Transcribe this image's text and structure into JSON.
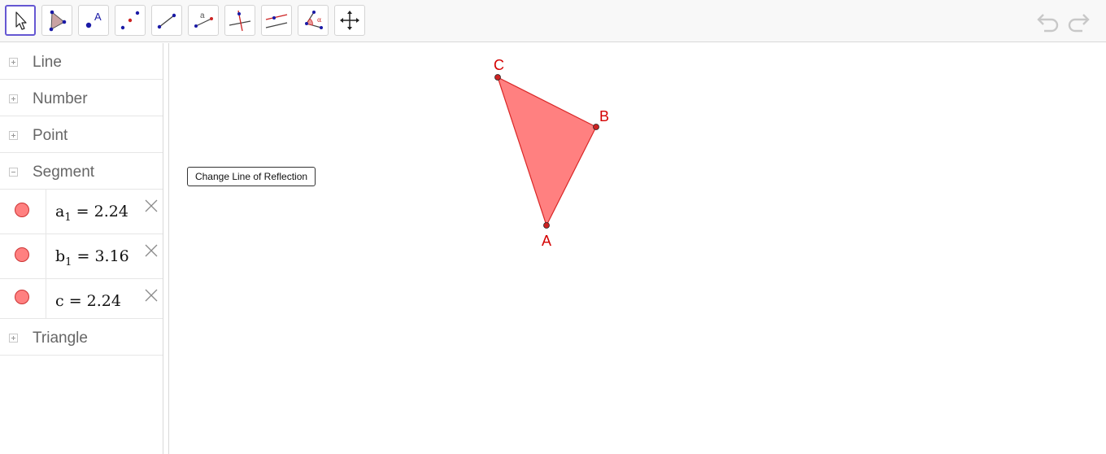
{
  "toolbar": {
    "tools": [
      {
        "name": "move-tool",
        "icon": "cursor-arrow-icon",
        "active": true
      },
      {
        "name": "polygon-tool",
        "icon": "triangle-polygon-icon"
      },
      {
        "name": "text-tool",
        "icon": "text-label-icon",
        "glyph": "A"
      },
      {
        "name": "point-tool",
        "icon": "points-icon"
      },
      {
        "name": "segment-tool",
        "icon": "segment-icon"
      },
      {
        "name": "slope-tool",
        "icon": "segment-label-icon",
        "glyph": "a"
      },
      {
        "name": "perpendicular-line-tool",
        "icon": "perpendicular-line-icon"
      },
      {
        "name": "parallel-line-tool",
        "icon": "parallel-line-icon"
      },
      {
        "name": "angle-tool",
        "icon": "angle-icon",
        "glyph": "α"
      },
      {
        "name": "move-graphics-view-tool",
        "icon": "move-arrows-icon"
      }
    ],
    "undo_icon": "undo-icon",
    "redo_icon": "redo-icon"
  },
  "algebra": {
    "groups": [
      {
        "label": "Line",
        "expanded": false
      },
      {
        "label": "Number",
        "expanded": false
      },
      {
        "label": "Point",
        "expanded": false
      },
      {
        "label": "Segment",
        "expanded": true
      },
      {
        "label": "Triangle",
        "expanded": false
      }
    ],
    "segment_items": [
      {
        "name": "a",
        "sub": "1",
        "eq": "=",
        "value": "2.24"
      },
      {
        "name": "b",
        "sub": "1",
        "eq": "=",
        "value": "3.16"
      },
      {
        "name": "c",
        "sub": "",
        "eq": "=",
        "value": "2.24"
      }
    ]
  },
  "graphics": {
    "button_label": "Change Line of Reflection",
    "points": [
      {
        "label": "A"
      },
      {
        "label": "B"
      },
      {
        "label": "C"
      }
    ],
    "colors": {
      "fill": "#ff8080",
      "stroke": "#d92626",
      "label": "#d40000",
      "point": "#cc2222"
    }
  }
}
